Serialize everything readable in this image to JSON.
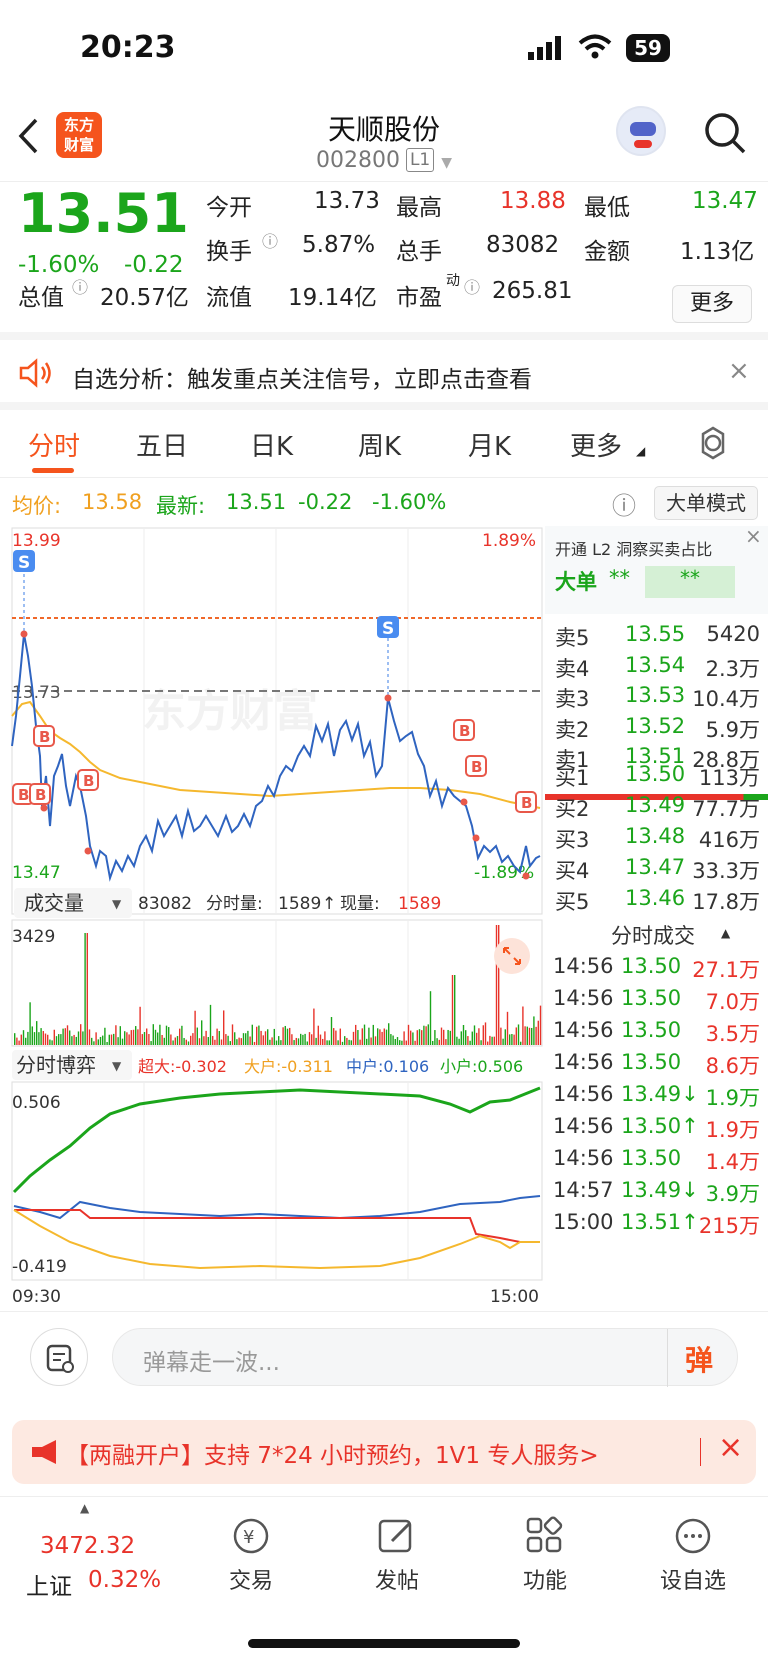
{
  "status": {
    "time": "20:23",
    "battery": "59"
  },
  "nav": {
    "logo": "东方\n财富",
    "title": "天顺股份",
    "code": "002800",
    "level": "L1"
  },
  "quote": {
    "price": "13.51",
    "pct": "-1.60%",
    "chg": "-0.22",
    "open_label": "今开",
    "open": "13.73",
    "high_label": "最高",
    "high": "13.88",
    "low_label": "最低",
    "low": "13.47",
    "turnover_label": "换手",
    "turnover": "5.87%",
    "vol_label": "总手",
    "vol": "83082",
    "amt_label": "金额",
    "amt": "1.13亿",
    "mcap_label": "总值",
    "mcap": "20.57亿",
    "float_label": "流值",
    "float": "19.14亿",
    "pe_label": "市盈",
    "pe_sup": "动",
    "pe": "265.81",
    "more": "更多"
  },
  "alert": {
    "text": "自选分析：触发重点关注信号，立即点击查看"
  },
  "tabs": [
    "分时",
    "五日",
    "日K",
    "周K",
    "月K",
    "更多"
  ],
  "avgbar": {
    "avg_label": "均价:",
    "avg": "13.58",
    "last_label": "最新:",
    "last": "13.51",
    "chg": "-0.22",
    "pct": "-1.60%",
    "bigmode": "大单模式"
  },
  "chart": {
    "ymax": "13.99",
    "ymin": "13.47",
    "pmax": "1.89%",
    "pmin": "-1.89%",
    "mid": "13.73",
    "vol_label": "成交量",
    "vol_total": "83082",
    "fen_label": "分时量:",
    "fen_val": "1589",
    "xian_label": "现量:",
    "xian_val": "1589",
    "vol_max": "3429",
    "boyi_label": "分时博弈",
    "chaoda": "超大:-0.302",
    "dahu": "大户:-0.311",
    "zhonghu": "中户:0.106",
    "xiaohu": "小户:0.506",
    "b_max": "0.506",
    "b_min": "-0.419",
    "t_start": "09:30",
    "t_end": "15:00",
    "watermark": "东方财富"
  },
  "orderbook": {
    "header": "开通 L2 洞察买卖占比",
    "big_label": "大单",
    "star1": "**",
    "star2": "**",
    "asks": [
      {
        "l": "卖5",
        "p": "13.55",
        "v": "5420"
      },
      {
        "l": "卖4",
        "p": "13.54",
        "v": "2.3万"
      },
      {
        "l": "卖3",
        "p": "13.53",
        "v": "10.4万"
      },
      {
        "l": "卖2",
        "p": "13.52",
        "v": "5.9万"
      },
      {
        "l": "卖1",
        "p": "13.51",
        "v": "28.8万"
      }
    ],
    "bids": [
      {
        "l": "买1",
        "p": "13.50",
        "v": "113万"
      },
      {
        "l": "买2",
        "p": "13.49",
        "v": "77.7万"
      },
      {
        "l": "买3",
        "p": "13.48",
        "v": "416万"
      },
      {
        "l": "买4",
        "p": "13.47",
        "v": "33.3万"
      },
      {
        "l": "买5",
        "p": "13.46",
        "v": "17.8万"
      }
    ],
    "ticks_title": "分时成交",
    "ticks": [
      {
        "t": "14:56",
        "p": "13.50",
        "v": "27.1万"
      },
      {
        "t": "14:56",
        "p": "13.50",
        "v": "7.0万"
      },
      {
        "t": "14:56",
        "p": "13.50",
        "v": "3.5万"
      },
      {
        "t": "14:56",
        "p": "13.50",
        "v": "8.6万"
      },
      {
        "t": "14:56",
        "p": "13.49↓",
        "v": "1.9万"
      },
      {
        "t": "14:56",
        "p": "13.50↑",
        "v": "1.9万"
      },
      {
        "t": "14:56",
        "p": "13.50",
        "v": "1.4万"
      },
      {
        "t": "14:57",
        "p": "13.49↓",
        "v": "3.9万"
      },
      {
        "t": "15:00",
        "p": "13.51↑",
        "v": "215万"
      }
    ]
  },
  "input": {
    "placeholder": "弹幕走一波...",
    "danmu_btn": "弹"
  },
  "banner": {
    "text": "【两融开户】支持 7*24 小时预约，1V1 专人服务>"
  },
  "tabbar": {
    "index_val": "3472.32",
    "index_name": "上证",
    "index_pct": "0.32%",
    "items": [
      "交易",
      "发帖",
      "功能",
      "设自选"
    ]
  }
}
